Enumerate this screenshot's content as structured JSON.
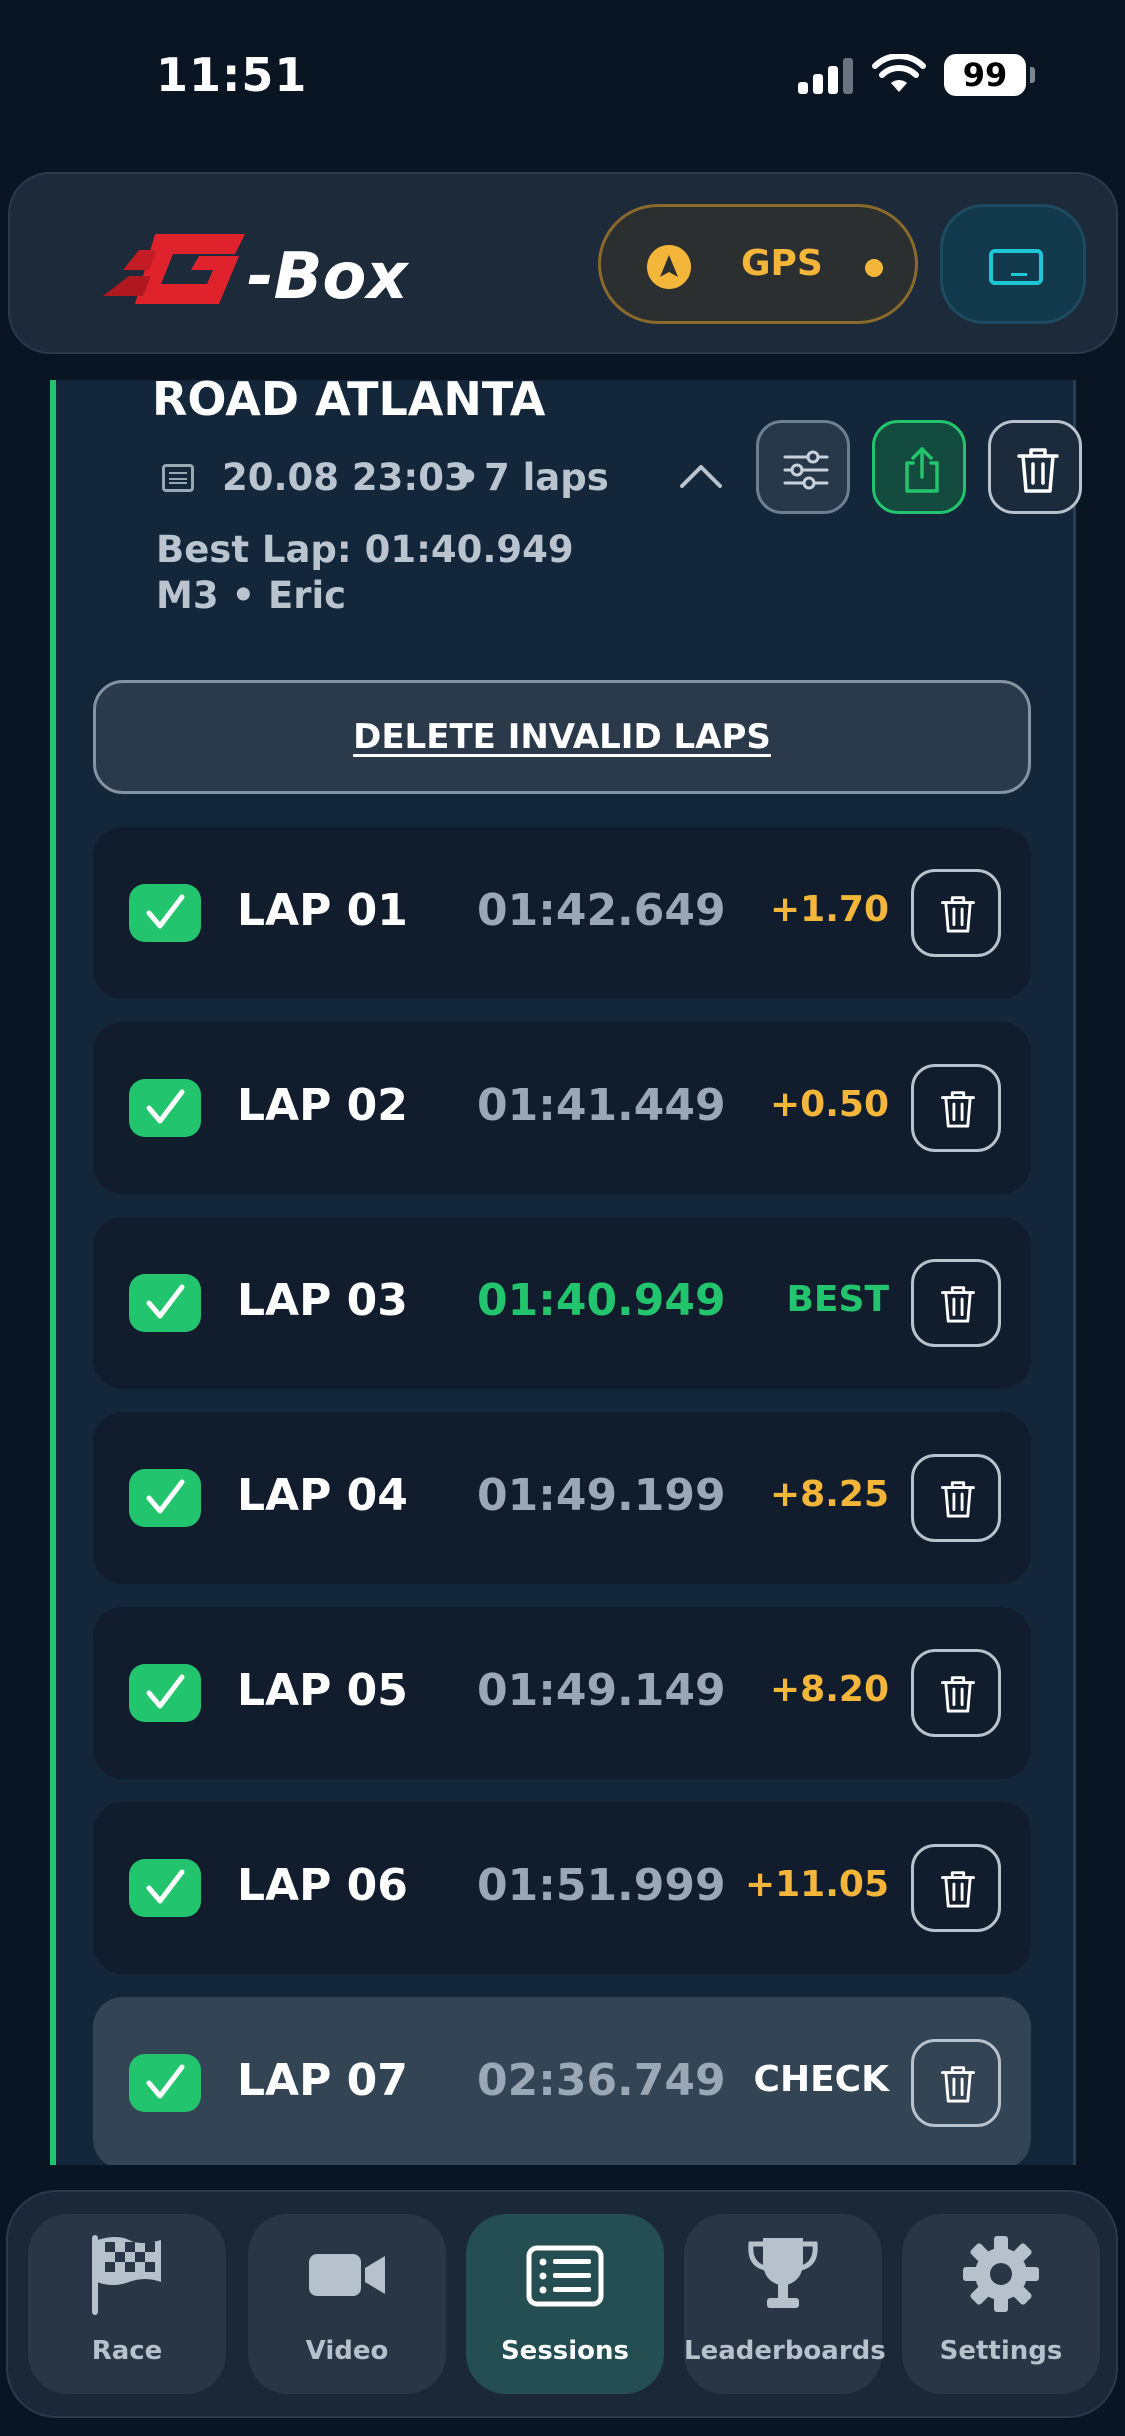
{
  "status_bar": {
    "time": "11:51",
    "battery": "99"
  },
  "header": {
    "logo_text": "G-Box",
    "gps_label": "GPS"
  },
  "session": {
    "track": "ROAD ATLANTA",
    "date": "20.08 23:03",
    "separator": "•",
    "laps": "7 laps",
    "best_lap": "Best Lap: 01:40.949",
    "car_driver": "M3  •  Eric"
  },
  "actions": {
    "delete_invalid": "DELETE INVALID LAPS"
  },
  "laps": [
    {
      "label": "LAP 01",
      "time": "01:42.649",
      "delta": "+1.70",
      "status": "slower"
    },
    {
      "label": "LAP 02",
      "time": "01:41.449",
      "delta": "+0.50",
      "status": "slower"
    },
    {
      "label": "LAP 03",
      "time": "01:40.949",
      "delta": "BEST",
      "status": "best"
    },
    {
      "label": "LAP 04",
      "time": "01:49.199",
      "delta": "+8.25",
      "status": "slower"
    },
    {
      "label": "LAP 05",
      "time": "01:49.149",
      "delta": "+8.20",
      "status": "slower"
    },
    {
      "label": "LAP 06",
      "time": "01:51.999",
      "delta": "+11.05",
      "status": "slower"
    },
    {
      "label": "LAP 07",
      "time": "02:36.749",
      "delta": "CHECK",
      "status": "check"
    }
  ],
  "nav": {
    "race": "Race",
    "video": "Video",
    "sessions": "Sessions",
    "leaderboards": "Leaderboards",
    "settings": "Settings",
    "active": "sessions"
  },
  "colors": {
    "accent_green": "#22c56e",
    "warning_amber": "#f3b53a",
    "brand_red": "#e0222c",
    "background": "#0a1524"
  }
}
